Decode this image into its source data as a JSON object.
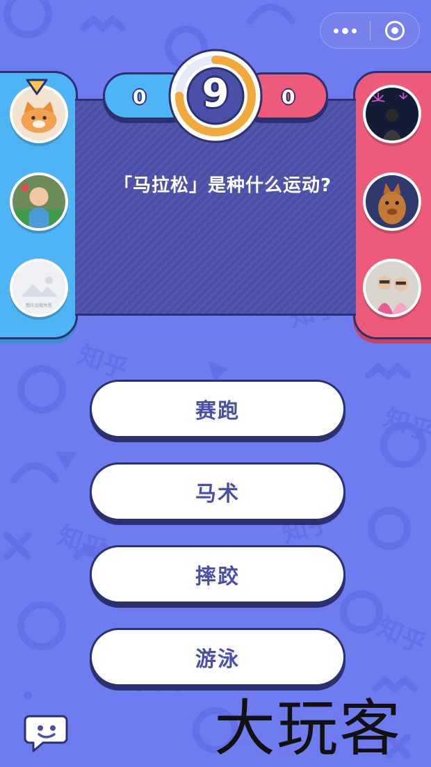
{
  "capsule": {
    "more_icon": "more-dots-icon",
    "close_icon": "target-circle-icon"
  },
  "scoreboard": {
    "left_score": "0",
    "right_score": "0",
    "timer": "9",
    "timer_progress": 0.75
  },
  "colors": {
    "background": "#6f7cf0",
    "team_left": "#4fb4f5",
    "team_right": "#ee5b7a",
    "outline": "#2b3070",
    "timer_ring": "#f2a93b",
    "answer_text": "#4a4fa8"
  },
  "players_left": [
    {
      "name": "player-left-1",
      "avatar": "orange-cat"
    },
    {
      "name": "player-left-2",
      "avatar": "baby-photo"
    },
    {
      "name": "player-left-3",
      "avatar": "placeholder-image",
      "caption": "图片加载失败"
    }
  ],
  "players_right": [
    {
      "name": "player-right-1",
      "avatar": "fireworks-person"
    },
    {
      "name": "player-right-2",
      "avatar": "cartoon-animal"
    },
    {
      "name": "player-right-3",
      "avatar": "kids-photo"
    }
  ],
  "question": {
    "text": "「马拉松」是种什么运动?"
  },
  "answers": [
    "赛跑",
    "马术",
    "摔跤",
    "游泳"
  ],
  "chat": {
    "icon": "chat-bubble-icon"
  },
  "watermark": {
    "text": "大玩客"
  }
}
